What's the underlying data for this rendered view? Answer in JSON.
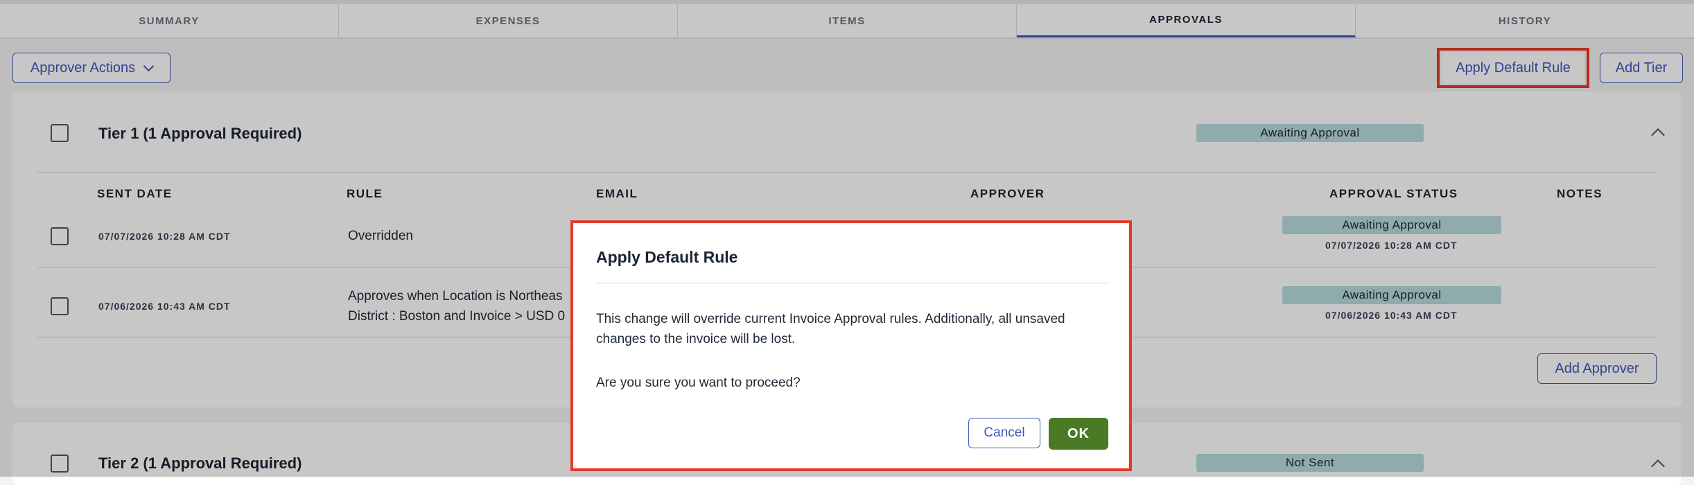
{
  "tabs": [
    {
      "label": "SUMMARY"
    },
    {
      "label": "EXPENSES"
    },
    {
      "label": "ITEMS"
    },
    {
      "label": "APPROVALS"
    },
    {
      "label": "HISTORY"
    }
  ],
  "active_tab": "APPROVALS",
  "toolbar": {
    "approver_actions_label": "Approver Actions",
    "apply_default_rule_label": "Apply Default Rule",
    "add_tier_label": "Add Tier"
  },
  "tier1": {
    "title": "Tier 1 (1 Approval Required)",
    "status": "Awaiting Approval",
    "columns": [
      "SENT DATE",
      "RULE",
      "EMAIL",
      "APPROVER",
      "APPROVAL STATUS",
      "NOTES"
    ],
    "rows": [
      {
        "sent_date": "07/07/2026 10:28 AM CDT",
        "rule": "Overridden",
        "status": "Awaiting Approval",
        "status_date": "07/07/2026 10:28 AM CDT"
      },
      {
        "sent_date": "07/06/2026 10:43 AM CDT",
        "rule_line1": "Approves when Location is Northeas",
        "rule_line2": "District : Boston and Invoice > USD 0",
        "status": "Awaiting Approval",
        "status_date": "07/06/2026 10:43 AM CDT"
      }
    ],
    "add_approver_label": "Add Approver"
  },
  "tier2": {
    "title": "Tier 2 (1 Approval Required)",
    "status": "Not Sent"
  },
  "modal": {
    "title": "Apply Default Rule",
    "body": "This change will override current Invoice Approval rules. Additionally, all unsaved changes to the invoice will be lost.",
    "question": "Are you sure you want to proceed?",
    "cancel_label": "Cancel",
    "ok_label": "OK"
  },
  "colors": {
    "accent": "#3f57b8",
    "highlight": "#e53a27",
    "ok_green": "#4a7a25",
    "badge": "#b9dcdc"
  }
}
